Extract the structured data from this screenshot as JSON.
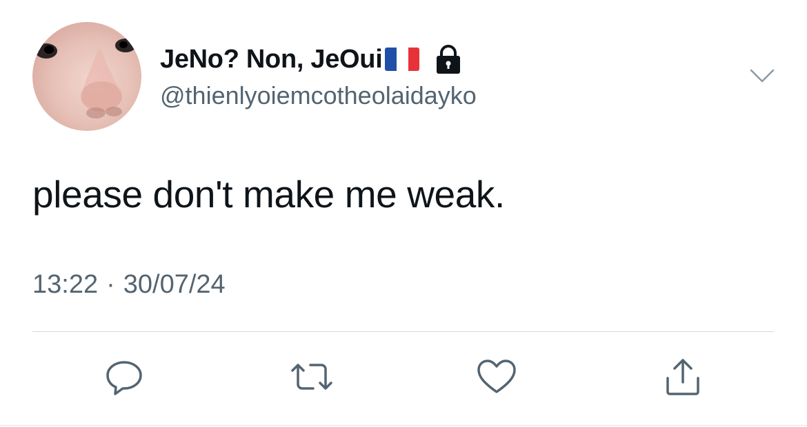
{
  "user": {
    "display_name": "JeNo? Non, JeOui",
    "handle": "@thienlyoiemcotheolaidayko",
    "flag_icon": "france-flag-icon",
    "lock_icon": "lock-icon",
    "avatar_icon": "profile-avatar"
  },
  "tweet": {
    "text": "please don't make me weak.",
    "time": "13:22",
    "separator": "·",
    "date": "30/07/24"
  },
  "actions": [
    {
      "name": "reply",
      "icon": "reply-icon"
    },
    {
      "name": "retweet",
      "icon": "retweet-icon"
    },
    {
      "name": "like",
      "icon": "heart-icon"
    },
    {
      "name": "share",
      "icon": "share-icon"
    }
  ],
  "colors": {
    "text_primary": "#0f1419",
    "text_secondary": "#536471",
    "icon_gray": "#536471",
    "divider": "#cfd9de",
    "flag_blue": "#1f4fa8",
    "flag_white": "#ffffff",
    "flag_red": "#e8323a"
  }
}
